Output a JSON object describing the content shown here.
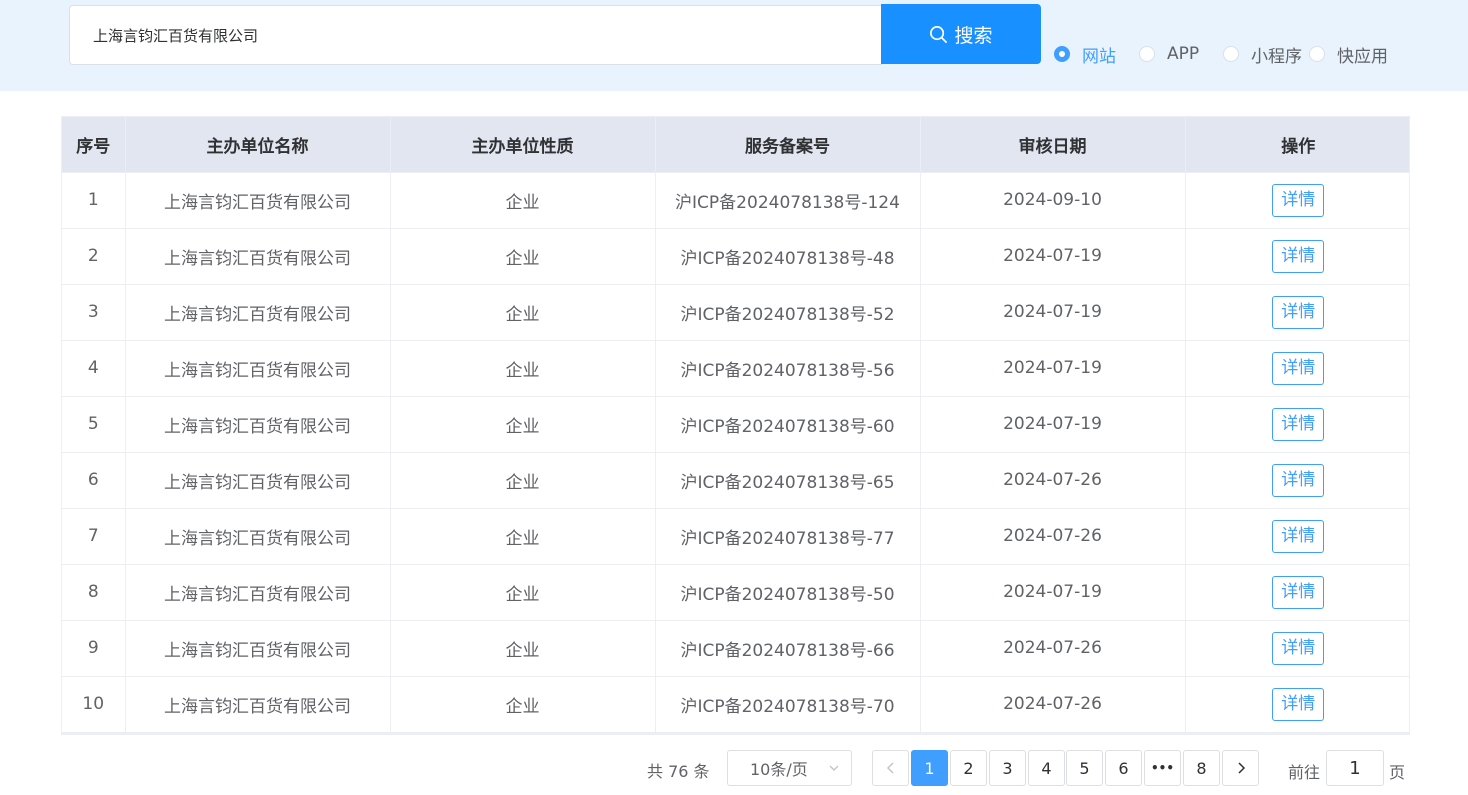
{
  "search": {
    "value": "上海言钧汇百货有限公司",
    "button_label": "搜索"
  },
  "type_options": [
    {
      "label": "网站",
      "checked": true
    },
    {
      "label": "APP",
      "checked": false
    },
    {
      "label": "小程序",
      "checked": false
    },
    {
      "label": "快应用",
      "checked": false
    }
  ],
  "table": {
    "columns": [
      "序号",
      "主办单位名称",
      "主办单位性质",
      "服务备案号",
      "审核日期",
      "操作"
    ],
    "action_label": "详情",
    "rows": [
      {
        "index": "1",
        "name": "上海言钧汇百货有限公司",
        "nature": "企业",
        "icp": "沪ICP备2024078138号-124",
        "date": "2024-09-10"
      },
      {
        "index": "2",
        "name": "上海言钧汇百货有限公司",
        "nature": "企业",
        "icp": "沪ICP备2024078138号-48",
        "date": "2024-07-19"
      },
      {
        "index": "3",
        "name": "上海言钧汇百货有限公司",
        "nature": "企业",
        "icp": "沪ICP备2024078138号-52",
        "date": "2024-07-19"
      },
      {
        "index": "4",
        "name": "上海言钧汇百货有限公司",
        "nature": "企业",
        "icp": "沪ICP备2024078138号-56",
        "date": "2024-07-19"
      },
      {
        "index": "5",
        "name": "上海言钧汇百货有限公司",
        "nature": "企业",
        "icp": "沪ICP备2024078138号-60",
        "date": "2024-07-19"
      },
      {
        "index": "6",
        "name": "上海言钧汇百货有限公司",
        "nature": "企业",
        "icp": "沪ICP备2024078138号-65",
        "date": "2024-07-26"
      },
      {
        "index": "7",
        "name": "上海言钧汇百货有限公司",
        "nature": "企业",
        "icp": "沪ICP备2024078138号-77",
        "date": "2024-07-26"
      },
      {
        "index": "8",
        "name": "上海言钧汇百货有限公司",
        "nature": "企业",
        "icp": "沪ICP备2024078138号-50",
        "date": "2024-07-19"
      },
      {
        "index": "9",
        "name": "上海言钧汇百货有限公司",
        "nature": "企业",
        "icp": "沪ICP备2024078138号-66",
        "date": "2024-07-26"
      },
      {
        "index": "10",
        "name": "上海言钧汇百货有限公司",
        "nature": "企业",
        "icp": "沪ICP备2024078138号-70",
        "date": "2024-07-26"
      }
    ]
  },
  "pagination": {
    "total_text": "共 76 条",
    "page_size": "10条/页",
    "pages": [
      "1",
      "2",
      "3",
      "4",
      "5",
      "6",
      "•••",
      "8"
    ],
    "current_page": "1",
    "goto_prefix": "前往",
    "goto_value": "1",
    "goto_suffix": "页"
  },
  "colors": {
    "accent": "#409eff",
    "search_button": "#1890ff",
    "top_band": "#e8f3fe",
    "header_bg": "#e1e6f0"
  },
  "icons": {
    "search": "search-icon",
    "prev": "chevron-left-icon",
    "next": "chevron-right-icon",
    "dropdown": "chevron-down-icon"
  }
}
